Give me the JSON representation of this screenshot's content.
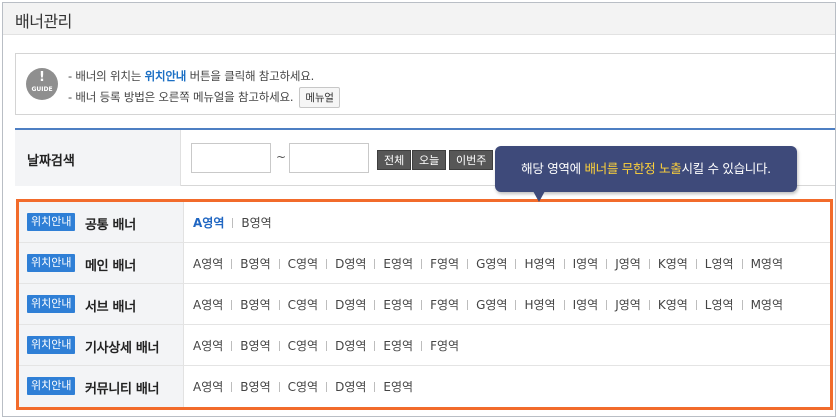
{
  "page": {
    "title": "배너관리"
  },
  "guide": {
    "icon_name": "guide-icon",
    "icon_mark": "!",
    "icon_text": "GUIDE",
    "line1_prefix": "- 배너의 위치는 ",
    "line1_highlight": "위치안내",
    "line1_suffix": " 버튼을 클릭해 참고하세요.",
    "line2": "- 배너 등록 방법은 오른쪽 메뉴얼을 참고하세요.",
    "manual_button": "메뉴얼",
    "highlight_color": "#1b6fc4"
  },
  "search": {
    "label": "날짜검색",
    "start_date": "",
    "end_date": "",
    "tilde": "~",
    "buttons": [
      "전체",
      "오늘",
      "이번주"
    ]
  },
  "tooltip": {
    "prefix": "해당 영역에 ",
    "highlight": "배너를 무한정 노출",
    "suffix": "시킬 수 있습니다.",
    "bg_color": "#3e4a7a",
    "highlight_color": "#ffd23a"
  },
  "banners": {
    "location_button": "위치안내",
    "highlight_border": "#f26b2b",
    "rows": [
      {
        "name": "공통 배너",
        "areas": [
          "A영역",
          "B영역"
        ],
        "active": 0
      },
      {
        "name": "메인 배너",
        "areas": [
          "A영역",
          "B영역",
          "C영역",
          "D영역",
          "E영역",
          "F영역",
          "G영역",
          "H영역",
          "I영역",
          "J영역",
          "K영역",
          "L영역",
          "M영역"
        ],
        "active": -1
      },
      {
        "name": "서브 배너",
        "areas": [
          "A영역",
          "B영역",
          "C영역",
          "D영역",
          "E영역",
          "F영역",
          "G영역",
          "H영역",
          "I영역",
          "J영역",
          "K영역",
          "L영역",
          "M영역"
        ],
        "active": -1
      },
      {
        "name": "기사상세 배너",
        "areas": [
          "A영역",
          "B영역",
          "C영역",
          "D영역",
          "E영역",
          "F영역"
        ],
        "active": -1
      },
      {
        "name": "커뮤니티 배너",
        "areas": [
          "A영역",
          "B영역",
          "C영역",
          "D영역",
          "E영역"
        ],
        "active": -1
      }
    ]
  }
}
